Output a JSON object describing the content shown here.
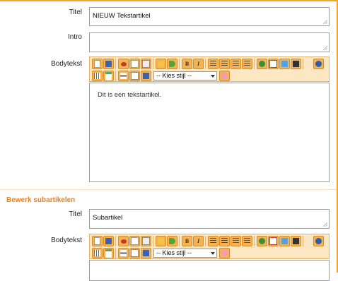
{
  "form": {
    "titel_label": "Titel",
    "titel_value": "NIEUW Tekstartikel",
    "intro_label": "Intro",
    "intro_value": "",
    "bodytekst_label": "Bodytekst",
    "bodytekst_content": "Dit is een tekstartikel."
  },
  "toolbar": {
    "style_select": "-- Kies stijl --",
    "bold_label": "B",
    "italic_label": "I",
    "icons_row1": [
      "new-document-icon",
      "save-icon",
      "cut-icon",
      "copy-icon",
      "paste-icon",
      "undo-icon",
      "redo-icon",
      "bold-icon",
      "italic-icon",
      "unordered-list-icon",
      "ordered-list-icon",
      "outdent-icon",
      "indent-icon",
      "anchor-icon",
      "link-icon",
      "image-icon",
      "media-icon",
      "source-icon"
    ],
    "icons_row2": [
      "table-icon",
      "calendar-icon",
      "hr-icon",
      "document-icon",
      "template-icon",
      "eraser-icon"
    ]
  },
  "subartikelen": {
    "heading": "Bewerk subartikelen",
    "titel_label": "Titel",
    "titel_value": "Subartikel",
    "bodytekst_label": "Bodytekst",
    "bodytekst_content": ""
  },
  "colors": {
    "accent": "#f5a623",
    "heading": "#e8811a",
    "toolbar_bg": "#fce7c2"
  }
}
